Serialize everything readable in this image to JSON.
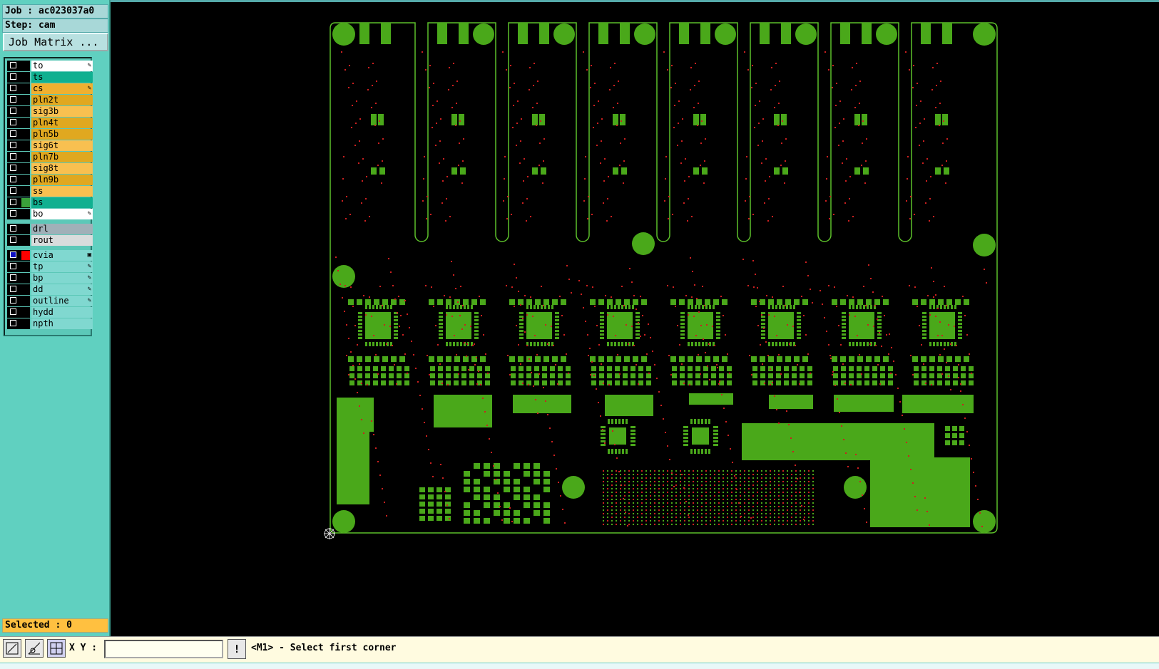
{
  "panel": {
    "job": "Job : ac023037a0",
    "step": "Step: cam",
    "job_matrix": "Job Matrix ...",
    "selected": "Selected : 0"
  },
  "layers": [
    {
      "name": "to",
      "bg": "#ffffff",
      "swatch": "#000000",
      "mark": "✎"
    },
    {
      "name": "ts",
      "bg": "#10b090",
      "swatch": "#000000",
      "mark": ""
    },
    {
      "name": "cs",
      "bg": "#f0b030",
      "swatch": "#000000",
      "mark": "✎"
    },
    {
      "name": "pln2t",
      "bg": "#e0a820",
      "swatch": "#000000",
      "mark": ""
    },
    {
      "name": "sig3b",
      "bg": "#f8c050",
      "swatch": "#000000",
      "mark": ""
    },
    {
      "name": "pln4t",
      "bg": "#e0a820",
      "swatch": "#000000",
      "mark": ""
    },
    {
      "name": "pln5b",
      "bg": "#e0a820",
      "swatch": "#000000",
      "mark": ""
    },
    {
      "name": "sig6t",
      "bg": "#f8c050",
      "swatch": "#000000",
      "mark": ""
    },
    {
      "name": "pln7b",
      "bg": "#e0a820",
      "swatch": "#000000",
      "mark": ""
    },
    {
      "name": "sig8t",
      "bg": "#f8c050",
      "swatch": "#000000",
      "mark": ""
    },
    {
      "name": "pln9b",
      "bg": "#e0a820",
      "swatch": "#000000",
      "mark": ""
    },
    {
      "name": "ss",
      "bg": "#f8c050",
      "swatch": "#000000",
      "mark": ""
    },
    {
      "name": "bs",
      "bg": "#10b090",
      "swatch": "#3aa03a",
      "mark": ""
    },
    {
      "name": "bo",
      "bg": "#ffffff",
      "swatch": "#000000",
      "mark": "✎"
    },
    {
      "name": "drl",
      "bg": "#a0b0b8",
      "swatch": "#000000",
      "mark": ""
    },
    {
      "name": "rout",
      "bg": "#d8dcdc",
      "swatch": "#000000",
      "mark": ""
    },
    {
      "name": "cvia",
      "bg": "#80d8d0",
      "swatch": "#ff0000",
      "mark": "▣"
    },
    {
      "name": "tp",
      "bg": "#80d8d0",
      "swatch": "#000000",
      "mark": "✎"
    },
    {
      "name": "bp",
      "bg": "#80d8d0",
      "swatch": "#000000",
      "mark": "✎"
    },
    {
      "name": "dd",
      "bg": "#80d8d0",
      "swatch": "#000000",
      "mark": "✎"
    },
    {
      "name": "outline",
      "bg": "#80d8d0",
      "swatch": "#000000",
      "mark": "✎"
    },
    {
      "name": "hydd",
      "bg": "#80d8d0",
      "swatch": "#000000",
      "mark": ""
    },
    {
      "name": "npth",
      "bg": "#80d8d0",
      "swatch": "#000000",
      "mark": ""
    }
  ],
  "bottom": {
    "xy_label": "X Y :",
    "xy_value": "",
    "excl": "!",
    "prompt": "<M1> - Select first corner"
  },
  "colors": {
    "copper": "#4aa81a",
    "outline": "#5cc02a",
    "drill": "#cc2020",
    "background": "#000000"
  }
}
